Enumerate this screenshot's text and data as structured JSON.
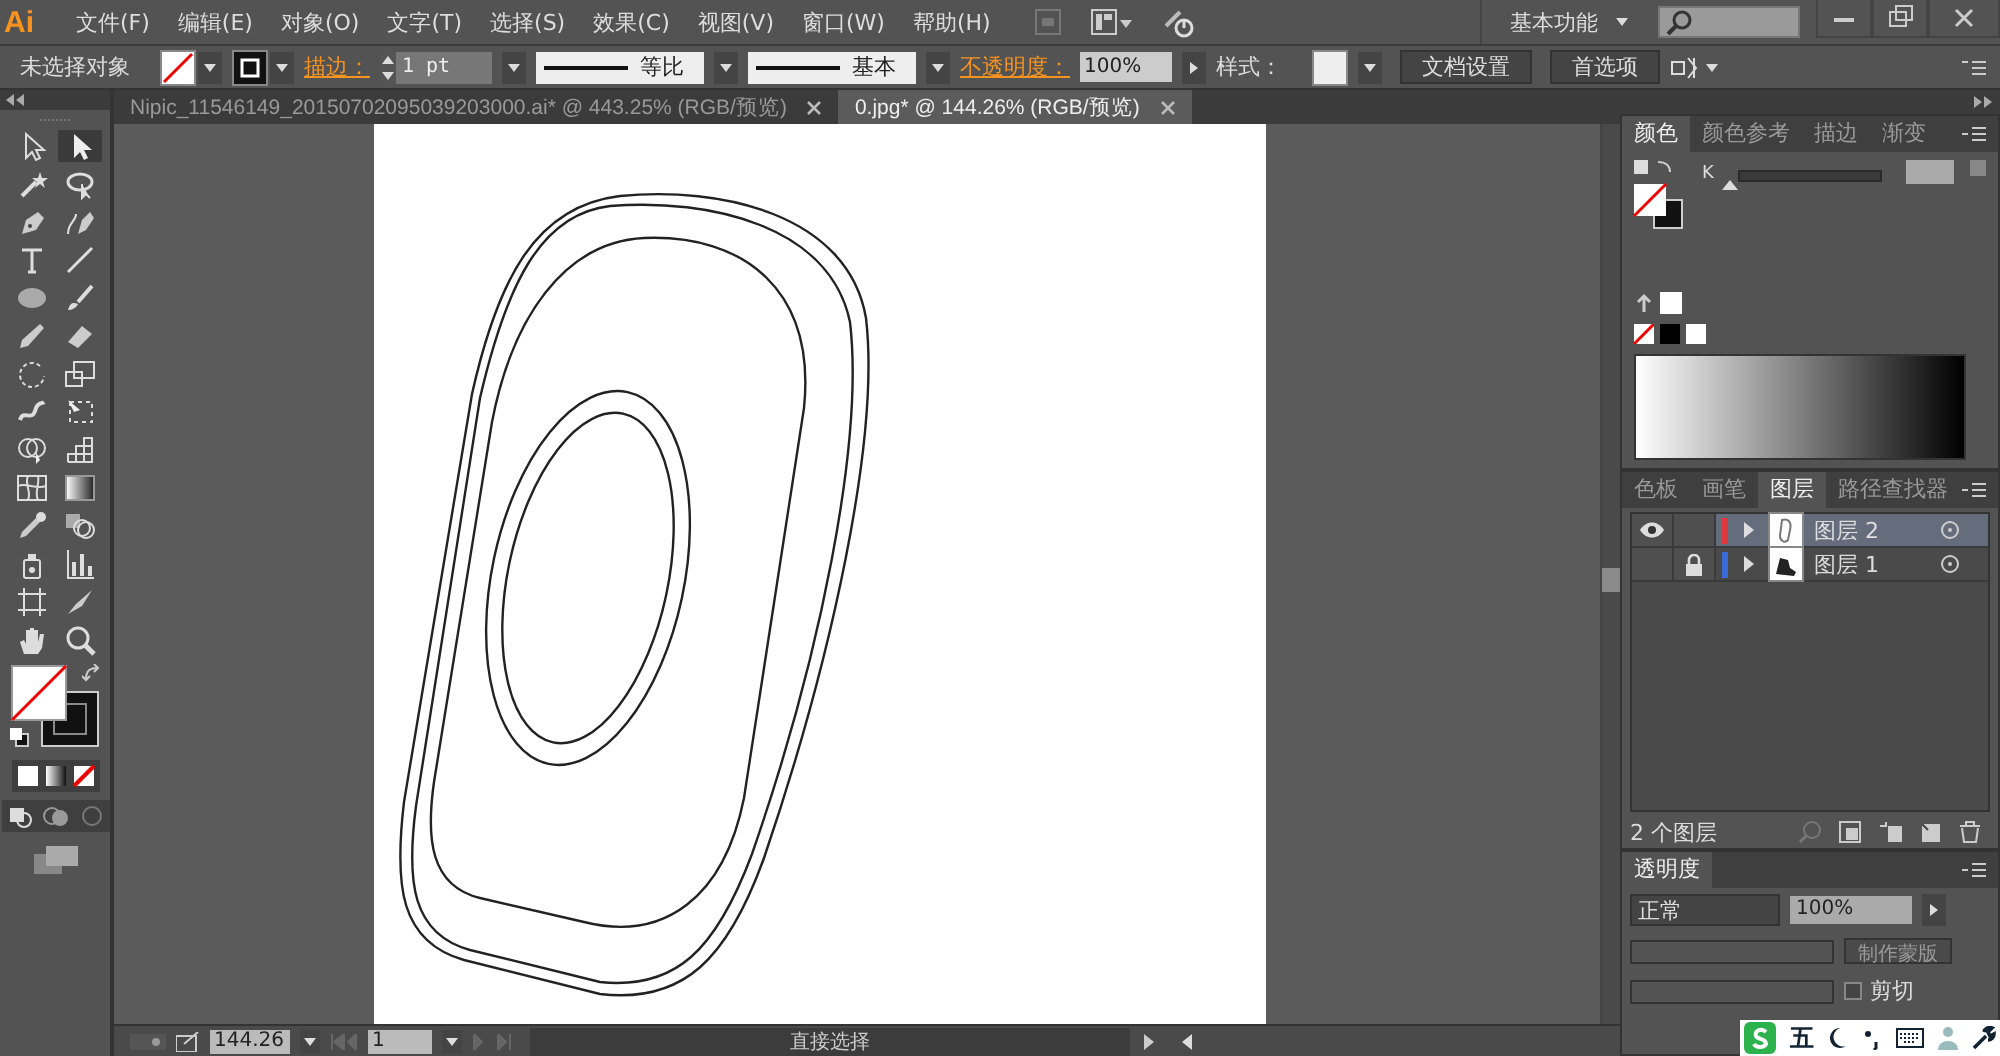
{
  "app": {
    "logo": "Ai"
  },
  "menu": [
    "文件(F)",
    "编辑(E)",
    "对象(O)",
    "文字(T)",
    "选择(S)",
    "效果(C)",
    "视图(V)",
    "窗口(W)",
    "帮助(H)"
  ],
  "workspace": {
    "label": "基本功能"
  },
  "control_bar": {
    "selection": "未选择对象",
    "stroke_label": "描边：",
    "stroke_weight": "1 pt",
    "stroke_profile": "等比",
    "brush": "基本",
    "opacity_label": "不透明度：",
    "opacity": "100%",
    "style_label": "样式：",
    "buttons": [
      "文档设置",
      "首选项"
    ]
  },
  "doc_tabs": [
    {
      "title": "Nipic_11546149_20150702095039203000.ai* @ 443.25% (RGB/预览)",
      "selected": false
    },
    {
      "title": "0.jpg* @ 144.26% (RGB/预览)",
      "selected": true
    }
  ],
  "tools": [
    {
      "kind": "selection",
      "selected": false
    },
    {
      "kind": "direct",
      "selected": true
    },
    {
      "kind": "wand",
      "selected": false
    },
    {
      "kind": "lasso",
      "selected": false
    },
    {
      "kind": "pen",
      "selected": false
    },
    {
      "kind": "curvature",
      "selected": false
    },
    {
      "kind": "type",
      "selected": false
    },
    {
      "kind": "line",
      "selected": false
    },
    {
      "kind": "ellipse",
      "selected": false
    },
    {
      "kind": "brush",
      "selected": false
    },
    {
      "kind": "pencil",
      "selected": false
    },
    {
      "kind": "eraser",
      "selected": false
    },
    {
      "kind": "rotate",
      "selected": false
    },
    {
      "kind": "scale",
      "selected": false
    },
    {
      "kind": "warp",
      "selected": false
    },
    {
      "kind": "transform",
      "selected": false
    },
    {
      "kind": "builder",
      "selected": false
    },
    {
      "kind": "perspective",
      "selected": false
    },
    {
      "kind": "mesh",
      "selected": false
    },
    {
      "kind": "gradient",
      "selected": false
    },
    {
      "kind": "eyedropper",
      "selected": false
    },
    {
      "kind": "blend",
      "selected": false
    },
    {
      "kind": "spray",
      "selected": false
    },
    {
      "kind": "graph",
      "selected": false
    },
    {
      "kind": "artboard",
      "selected": false
    },
    {
      "kind": "knife",
      "selected": false
    },
    {
      "kind": "hand",
      "selected": false
    },
    {
      "kind": "zoom",
      "selected": false
    }
  ],
  "color_panel": {
    "tabs": [
      {
        "label": "颜色",
        "selected": true
      },
      {
        "label": "颜色参考",
        "selected": false
      },
      {
        "label": "描边",
        "selected": false
      },
      {
        "label": "渐变",
        "selected": false
      }
    ],
    "channel": "K",
    "level": 0
  },
  "layers_panel": {
    "tabs": [
      {
        "label": "色板",
        "selected": false
      },
      {
        "label": "画笔",
        "selected": false
      },
      {
        "label": "图层",
        "selected": true
      },
      {
        "label": "路径查找器",
        "selected": false
      }
    ],
    "layers": [
      {
        "name": "图层 2",
        "visible": true,
        "locked": false,
        "expanded": false,
        "selected": true,
        "color": "#e0383a"
      },
      {
        "name": "图层 1",
        "visible": false,
        "locked": true,
        "expanded": false,
        "selected": false,
        "color": "#3a6bd8"
      }
    ],
    "count": "2 个图层"
  },
  "transparency_panel": {
    "tab": "透明度",
    "mode": "正常",
    "opacity": "100%",
    "mask_button": "制作蒙版",
    "clip": "剪切",
    "clip_checked": false
  },
  "status_bar": {
    "zoom": "144.26",
    "page": "1",
    "tool": "直接选择"
  },
  "ime": {
    "label": "五"
  }
}
